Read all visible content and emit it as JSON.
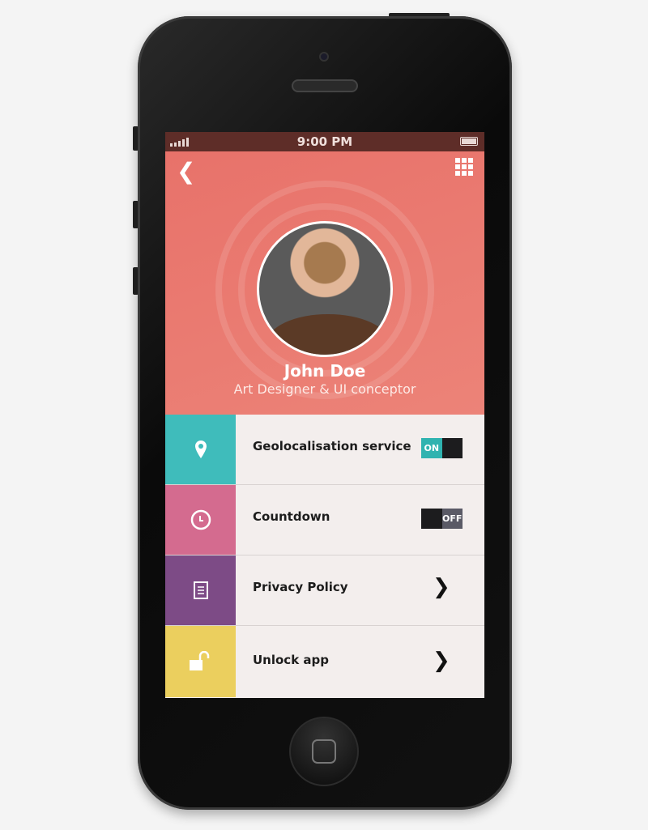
{
  "status_bar": {
    "time": "9:00 PM",
    "signal-icon": "signal-bars",
    "battery-icon": "battery-full"
  },
  "header": {
    "back_icon": "chevron-left",
    "menu_icon": "grid-3x3",
    "name": "John Doe",
    "role": "Art Designer & UI conceptor",
    "color": "#e8746a"
  },
  "settings": [
    {
      "label": "Geolocalisation service",
      "icon": "map-pin",
      "color": "#3fbcbb",
      "control": "toggle",
      "value": "ON"
    },
    {
      "label": "Countdown",
      "icon": "clock",
      "color": "#d46b8f",
      "control": "toggle",
      "value": "OFF"
    },
    {
      "label": "Privacy Policy",
      "icon": "document",
      "color": "#7d4b86",
      "control": "chevron"
    },
    {
      "label": "Unlock app",
      "icon": "unlock",
      "color": "#ebcf5e",
      "control": "chevron"
    }
  ]
}
